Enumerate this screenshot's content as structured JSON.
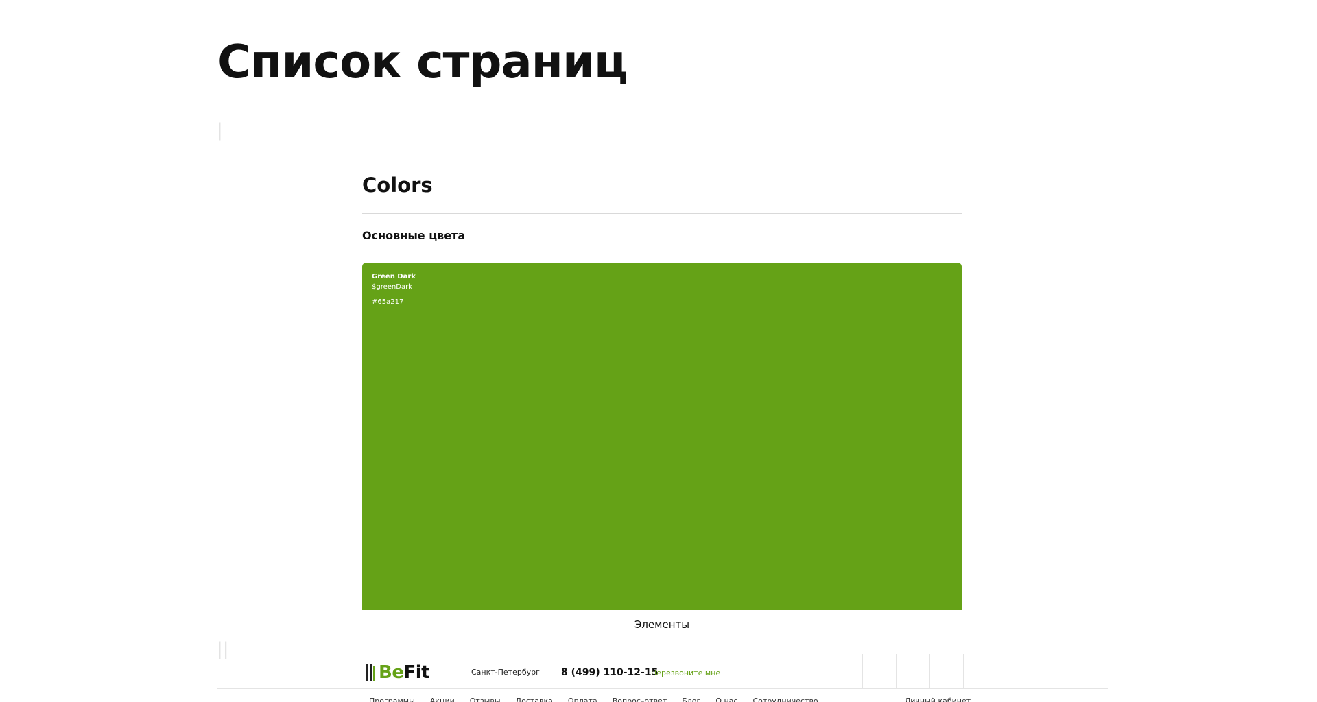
{
  "page": {
    "title": "Список страниц"
  },
  "colors_section": {
    "title": "Colors",
    "subtitle": "Основные цвета",
    "swatch": {
      "name": "Green Dark",
      "variable": "$greenDark",
      "hex": "#65a217",
      "color": "#65a217"
    },
    "footer_label": "Элементы"
  },
  "site_header": {
    "logo": {
      "part1": "Be",
      "part2": "Fit",
      "accent_color": "#65a217"
    },
    "city": "Санкт-Петербург",
    "phone": "8 (499) 110-12-15",
    "callback": "Перезвоните мне",
    "nav": [
      "Программы",
      "Акции",
      "Отзывы",
      "Доставка",
      "Оплата",
      "Вопрос–ответ",
      "Блог",
      "О нас",
      "Сотрудничество"
    ],
    "account": "Личный кабинет"
  }
}
